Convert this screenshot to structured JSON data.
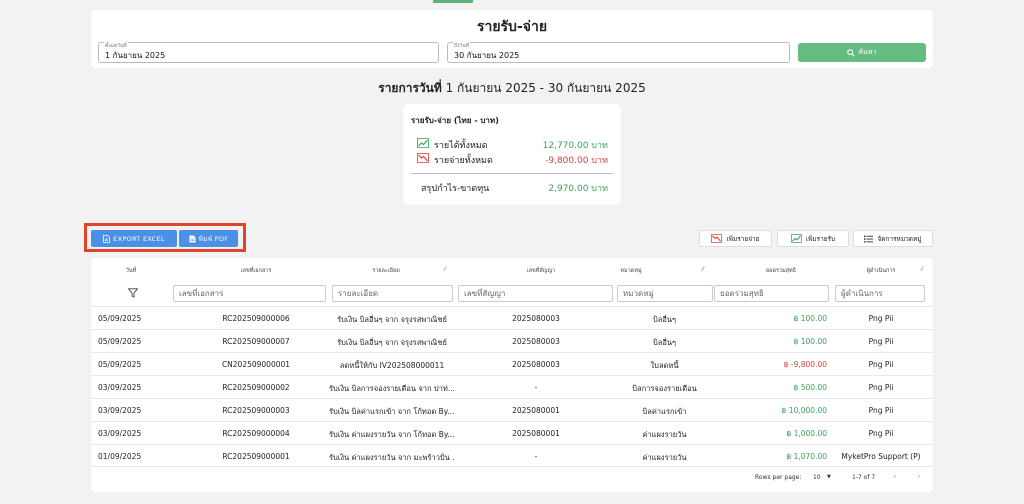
{
  "header": {
    "title": "รายรับ-จ่าย",
    "start_date_label": "ตั้งแต่วันที่",
    "start_date_value": "1 กันยายน 2025",
    "end_date_label": "ถึงวันที่",
    "end_date_value": "30 กันยายน 2025",
    "search_label": "ค้นหา"
  },
  "range": {
    "prefix": "รายการวันที่",
    "value": " 1 กันยายน 2025 - 30 กันยายน 2025"
  },
  "summary": {
    "title": "รายรับ-จ่าย (ไทย - บาท)",
    "income_label": "รายได้ทั้งหมด",
    "income_value": "12,770.00 บาท",
    "expense_label": "รายจ่ายทั้งหมด",
    "expense_value": "-9,800.00 บาท",
    "net_label": "สรุปกำไร-ขาดทุน",
    "net_value": "2,970.00 บาท"
  },
  "toolbar": {
    "export_excel": "EXPORT EXCEL",
    "print_pdf": "พิมพ์ PDF",
    "add_expense": "เพิ่มรายจ่าย",
    "add_income": "เพิ่มรายรับ",
    "manage_categories": "จัดการหมวดหมู่"
  },
  "table": {
    "headers": [
      "วันที่",
      "เลขที่เอกสาร",
      "รายละเอียด",
      "เลขที่สัญญา",
      "หมวดหมู่",
      "ยอดรวมสุทธิ",
      "ผู้ดำเนินการ"
    ],
    "filters": [
      "เลขที่เอกสาร",
      "รายละเอียด",
      "เลขที่สัญญา",
      "หมวดหมู่",
      "ยอดรวมสุทธิ",
      "ผู้ดำเนินการ"
    ],
    "rows": [
      {
        "date": "05/09/2025",
        "doc": "RC202509000006",
        "detail": "รับเงิน บิลอื่นๆ จาก จรุงรสพาณิชย์",
        "contract": "2025080003",
        "category": "บิลอื่นๆ",
        "amount": "฿ 100.00",
        "user": "Png Pii"
      },
      {
        "date": "05/09/2025",
        "doc": "RC202509000007",
        "detail": "รับเงิน บิลอื่นๆ จาก จรุงรสพาณิชย์",
        "contract": "2025080003",
        "category": "บิลอื่นๆ",
        "amount": "฿ 100.00",
        "user": "Png Pii"
      },
      {
        "date": "05/09/2025",
        "doc": "CN202509000001",
        "detail": "ลดหนี้ให้กับ IV202508000011",
        "contract": "2025080003",
        "category": "ใบลดหนี้",
        "amount": "฿ -9,800.00",
        "user": "Png Pii"
      },
      {
        "date": "03/09/2025",
        "doc": "RC202509000002",
        "detail": "รับเงิน บิลการจองรายเดือน จาก ปาท่...",
        "contract": "-",
        "category": "บิลการจองรายเดือน",
        "amount": "฿ 500.00",
        "user": "Png Pii"
      },
      {
        "date": "03/09/2025",
        "doc": "RC202509000003",
        "detail": "รับเงิน บิลค่าแรกเข้า จาก โก้ทอด By.…",
        "contract": "2025080001",
        "category": "บิลค่าแรกเข้า",
        "amount": "฿ 10,000.00",
        "user": "Png Pii"
      },
      {
        "date": "03/09/2025",
        "doc": "RC202509000004",
        "detail": "รับเงิน ค่าแผงรายวัน จาก โก้ทอด By.…",
        "contract": "2025080001",
        "category": "ค่าแผงรายวัน",
        "amount": "฿ 1,000.00",
        "user": "Png Pii"
      },
      {
        "date": "01/09/2025",
        "doc": "RC202509000001",
        "detail": "รับเงิน ค่าแผงรายวัน จาก มะพร้าวปั่น …",
        "contract": "-",
        "category": "ค่าแผงรายวัน",
        "amount": "฿ 1,070.00",
        "user": "MyketPro Support (P)"
      }
    ]
  },
  "pager": {
    "rows_per_page_label": "Rows per page:",
    "rows_per_page_value": "10",
    "range_text": "1-7 of 7"
  },
  "colors": {
    "income": "#3aa45a",
    "expense": "#d9433a",
    "primary_button": "#4b8fe6",
    "search_button": "#66bb80",
    "highlight_box": "#e0442c"
  }
}
